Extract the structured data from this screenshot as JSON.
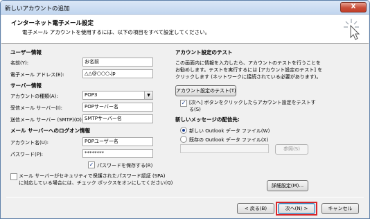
{
  "window": {
    "title": "新しいアカウントの追加",
    "close_label": "X"
  },
  "header": {
    "title": "インターネット電子メール設定",
    "subtitle": "電子メール アカウントを使用するには、以下の項目をすべて設定してください。",
    "icon": "pointer-click-icon"
  },
  "user_info": {
    "section_title": "ユーザー情報",
    "name_label": "名前(Y):",
    "name_value": "お名前",
    "email_label": "電子メール アドレス(E):",
    "email_value": "△△@○○○.jp"
  },
  "server_info": {
    "section_title": "サーバー情報",
    "account_type_label": "アカウントの種類(A):",
    "account_type_value": "POP3",
    "incoming_label": "受信メール サーバー(I):",
    "incoming_value": "POPサーバー名",
    "outgoing_label": "送信メール サーバー (SMTP)(O):",
    "outgoing_value": "SMTPサーバー名"
  },
  "logon_info": {
    "section_title": "メール サーバーへのログオン情報",
    "account_name_label": "アカウント名(U):",
    "account_name_value": "POPユーザー名",
    "password_label": "パスワード(P):",
    "password_value": "********",
    "remember_password_label": "パスワードを保存する(R)",
    "remember_password_checked": true,
    "spa_label_line1": "メール サーバーがセキュリティで保護されたパスワード認証 (SPA)",
    "spa_label_line2": "に対応している場合には、チェック ボックスをオンにしてください(Q)",
    "spa_checked": false
  },
  "test": {
    "section_title": "アカウント設定のテスト",
    "desc_line1": "この画面内に情報を入力したら、アカウントのテストを行うことを",
    "desc_line2": "お勧めします。テストを実行するには [アカウント設定のテスト] を",
    "desc_line3": "クリックします (ネットワークに接続されている必要があります)。",
    "test_button": "アカウント設定のテスト(T)",
    "auto_test_line1": "[次へ] ボタンをクリックしたらアカウント設定をテストす",
    "auto_test_line2": "る(S)",
    "auto_test_checked": true
  },
  "delivery": {
    "section_title": "新しいメッセージの配信先:",
    "new_data_file": "新しい Outlook データ ファイル(W)",
    "existing_data_file": "既存の Outlook データ ファイル(X)",
    "selected": "new",
    "path_value": "",
    "browse_button": "参照(S)"
  },
  "more_settings_button": "詳細設定(M)...",
  "footer": {
    "back_button": "< 戻る(B)",
    "next_button": "次へ(N) >",
    "cancel_button": "キャンセル"
  }
}
